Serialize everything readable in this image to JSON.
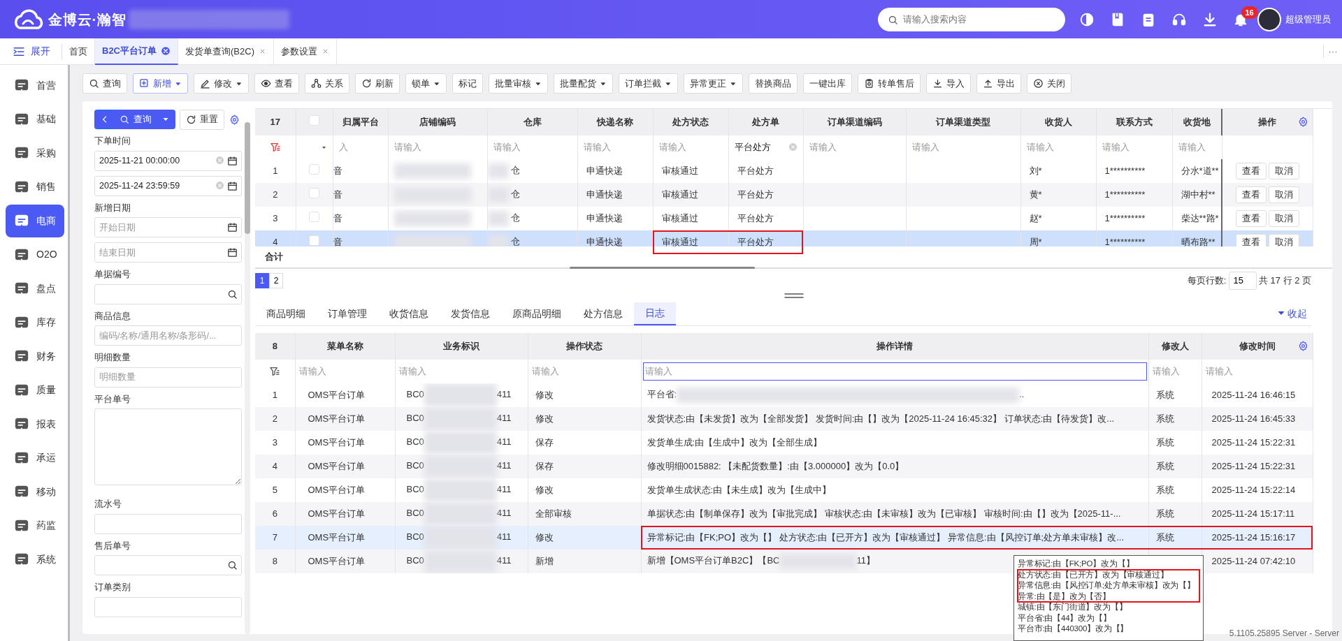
{
  "header": {
    "brand": "金博云·瀚智",
    "search_placeholder": "请输入搜索内容",
    "notifications": "16",
    "user": "超级管理员"
  },
  "tabs_bar": {
    "toggle": "展开",
    "more": "···",
    "tabs": [
      {
        "label": "首页",
        "selected": false,
        "closable": false
      },
      {
        "label": "B2C平台订单",
        "selected": true,
        "closable": true
      },
      {
        "label": "发货单查询(B2C)",
        "selected": false,
        "closable": true
      },
      {
        "label": "参数设置",
        "selected": false,
        "closable": true
      }
    ]
  },
  "sidebar": {
    "items": [
      {
        "label": "首营",
        "selected": false
      },
      {
        "label": "基础",
        "selected": false
      },
      {
        "label": "采购",
        "selected": false
      },
      {
        "label": "销售",
        "selected": false
      },
      {
        "label": "电商",
        "selected": true
      },
      {
        "label": "O2O",
        "selected": false
      },
      {
        "label": "盘点",
        "selected": false
      },
      {
        "label": "库存",
        "selected": false
      },
      {
        "label": "财务",
        "selected": false
      },
      {
        "label": "质量",
        "selected": false
      },
      {
        "label": "报表",
        "selected": false
      },
      {
        "label": "承运",
        "selected": false
      },
      {
        "label": "移动",
        "selected": false
      },
      {
        "label": "药监",
        "selected": false
      },
      {
        "label": "系统",
        "selected": false
      }
    ]
  },
  "toolbar": [
    {
      "label": "查询",
      "dropdown": false,
      "accent": false
    },
    {
      "label": "新增",
      "dropdown": true,
      "accent": true
    },
    {
      "label": "修改",
      "dropdown": true,
      "accent": false
    },
    {
      "label": "查看",
      "dropdown": false,
      "accent": false
    },
    {
      "label": "关系",
      "dropdown": false,
      "accent": false
    },
    {
      "label": "刷新",
      "dropdown": false,
      "accent": false
    },
    {
      "label": "锁单",
      "dropdown": true,
      "accent": false
    },
    {
      "label": "标记",
      "dropdown": false,
      "accent": false
    },
    {
      "label": "批量审核",
      "dropdown": true,
      "accent": false
    },
    {
      "label": "批量配货",
      "dropdown": true,
      "accent": false
    },
    {
      "label": "订单拦截",
      "dropdown": true,
      "accent": false
    },
    {
      "label": "异常更正",
      "dropdown": true,
      "accent": false
    },
    {
      "label": "替换商品",
      "dropdown": false,
      "accent": false
    },
    {
      "label": "一键出库",
      "dropdown": false,
      "accent": false
    },
    {
      "label": "转单售后",
      "dropdown": false,
      "accent": false
    },
    {
      "label": "导入",
      "dropdown": false,
      "accent": false
    },
    {
      "label": "导出",
      "dropdown": false,
      "accent": false
    },
    {
      "label": "关闭",
      "dropdown": false,
      "accent": false
    }
  ],
  "filter_panel": {
    "query": "查询",
    "reset": "重置",
    "fields": [
      {
        "label": "下单时间",
        "kind": "date",
        "value": "2025-11-21 00:00:00"
      },
      {
        "kind": "date",
        "value": "2025-11-24 23:59:59"
      },
      {
        "label": "新增日期",
        "kind": "date",
        "placeholder": "开始日期"
      },
      {
        "kind": "date",
        "placeholder": "结束日期"
      },
      {
        "label": "单据编号",
        "kind": "search"
      },
      {
        "label": "商品信息",
        "kind": "text",
        "placeholder": "编码/名称/通用名称/条形码/..."
      },
      {
        "label": "明细数量",
        "kind": "text",
        "placeholder": "明细数量"
      },
      {
        "label": "平台单号",
        "kind": "textarea"
      },
      {
        "label": "流水号",
        "kind": "text"
      },
      {
        "label": "售后单号",
        "kind": "search"
      },
      {
        "label": "订单类别",
        "kind": "text"
      }
    ]
  },
  "orders": {
    "count": "17",
    "all_checked": false,
    "columns": [
      "归属平台",
      "店铺编码",
      "仓库",
      "快递名称",
      "处方状态",
      "处方单",
      "订单渠道编码",
      "订单渠道类型",
      "收货人",
      "联系方式",
      "收货地",
      "操作"
    ],
    "filters": [
      "入",
      "请输入",
      "请输入",
      "请输入",
      "请输入",
      "平台处方",
      "请输入",
      "请输入",
      "请输入",
      "请输入",
      "请输入"
    ],
    "rows": [
      {
        "no": "1",
        "checked": false,
        "selected": false,
        "flagged": false,
        "platform": "音",
        "warehouse": "仓",
        "courier": "申通快递",
        "rx_status": "审核通过",
        "rx": "平台处方",
        "receiver": "刘*",
        "phone": "1**********",
        "address": "分水*道**",
        "actions": [
          "查看",
          "取消"
        ]
      },
      {
        "no": "2",
        "checked": false,
        "selected": false,
        "flagged": false,
        "platform": "音",
        "warehouse": "仓",
        "courier": "申通快递",
        "rx_status": "审核通过",
        "rx": "平台处方",
        "receiver": "黄*",
        "phone": "1**********",
        "address": "湖中村**",
        "actions": [
          "查看",
          "取消"
        ]
      },
      {
        "no": "3",
        "checked": false,
        "selected": false,
        "flagged": false,
        "platform": "音",
        "warehouse": "仓",
        "courier": "申通快递",
        "rx_status": "审核通过",
        "rx": "平台处方",
        "receiver": "赵*",
        "phone": "1**********",
        "address": "柴达**路*",
        "actions": [
          "查看",
          "取消"
        ]
      },
      {
        "no": "4",
        "checked": false,
        "selected": true,
        "flagged": true,
        "platform": "音",
        "warehouse": "仓",
        "courier": "申通快递",
        "rx_status": "审核通过",
        "rx": "平台处方",
        "receiver": "周*",
        "phone": "1**********",
        "address": "晒布路**",
        "actions": [
          "查看",
          "取消"
        ]
      }
    ],
    "summary": "合计",
    "pages": [
      {
        "label": "1",
        "selected": true
      },
      {
        "label": "2",
        "selected": false
      }
    ],
    "page_size_label": "每页行数:",
    "page_size": "15",
    "total": "共 17 行 2 页"
  },
  "detail_tabs": {
    "collapse": "收起",
    "tabs": [
      {
        "label": "商品明细",
        "selected": false
      },
      {
        "label": "订单管理",
        "selected": false
      },
      {
        "label": "收货信息",
        "selected": false
      },
      {
        "label": "发货信息",
        "selected": false
      },
      {
        "label": "原商品明细",
        "selected": false
      },
      {
        "label": "处方信息",
        "selected": false
      },
      {
        "label": "日志",
        "selected": true
      }
    ]
  },
  "log": {
    "count": "8",
    "columns": [
      "菜单名称",
      "业务标识",
      "操作状态",
      "操作详情",
      "修改人",
      "修改时间"
    ],
    "filters": [
      {
        "placeholder": "请输入",
        "focused": false
      },
      {
        "placeholder": "请输入",
        "focused": false
      },
      {
        "placeholder": "请输入",
        "focused": false
      },
      {
        "placeholder": "请输入",
        "focused": true
      },
      {
        "placeholder": "请输入",
        "focused": false
      },
      {
        "placeholder": "请输入",
        "focused": false
      }
    ],
    "rows": [
      {
        "no": "1",
        "menu": "OMS平台订单",
        "id_start": "BC0",
        "id_end": "411",
        "status": "修改",
        "detail": "平台省:",
        "detail_redacted": true,
        "detail_end": "..",
        "user": "系统",
        "time": "2025-11-24 16:46:15",
        "selected": false,
        "flagged": false
      },
      {
        "no": "2",
        "menu": "OMS平台订单",
        "id_start": "BC0",
        "id_end": "411",
        "status": "修改",
        "detail": "发货状态:由【未发货】改为【全部发货】 发货时间:由【】改为【2025-11-24 16:45:32】 订单状态:由【待发货】改...",
        "user": "系统",
        "time": "2025-11-24 16:45:33",
        "selected": false,
        "flagged": false
      },
      {
        "no": "3",
        "menu": "OMS平台订单",
        "id_start": "BC0",
        "id_end": "411",
        "status": "保存",
        "detail": "发货单生成:由【生成中】改为【全部生成】",
        "user": "系统",
        "time": "2025-11-24 15:22:31",
        "selected": false,
        "flagged": false
      },
      {
        "no": "4",
        "menu": "OMS平台订单",
        "id_start": "BC0",
        "id_end": "411",
        "status": "保存",
        "detail": "修改明细0015882: 【未配货数量】:由【3.000000】改为【0.0】",
        "user": "系统",
        "time": "2025-11-24 15:22:31",
        "selected": false,
        "flagged": false
      },
      {
        "no": "5",
        "menu": "OMS平台订单",
        "id_start": "BC0",
        "id_end": "411",
        "status": "修改",
        "detail": "发货单生成状态:由【未生成】改为【生成中】",
        "user": "系统",
        "time": "2025-11-24 15:22:14",
        "selected": false,
        "flagged": false
      },
      {
        "no": "6",
        "menu": "OMS平台订单",
        "id_start": "BC0",
        "id_end": "411",
        "status": "全部审核",
        "detail": "单据状态:由【制单保存】改为【审批完成】 审核状态:由【未审核】改为【已审核】 审核时间:由【】改为【2025-11-...",
        "user": "系统",
        "time": "2025-11-24 15:17:11",
        "selected": false,
        "flagged": false
      },
      {
        "no": "7",
        "menu": "OMS平台订单",
        "id_start": "BC0",
        "id_end": "411",
        "status": "修改",
        "detail": "异常标记:由【FK;PO】改为【】 处方状态:由【已开方】改为【审核通过】 异常信息:由【风控订单;处方单未审核】改...",
        "user": "系统",
        "time": "2025-11-24 15:16:17",
        "selected": true,
        "flagged": true
      },
      {
        "no": "8",
        "menu": "OMS平台订单",
        "id_start": "BC0",
        "id_end": "411",
        "status": "新增",
        "detail": "新增【OMS平台订单B2C】【BC",
        "detail_redacted": true,
        "detail_end": "11】",
        "time": "2025-11-24 07:42:10",
        "selected": false,
        "flagged": false
      }
    ]
  },
  "tooltip": {
    "lines": [
      {
        "text": "异常标记:由【FK;PO】改为【】",
        "flagged": false
      },
      {
        "text": "处方状态:由【已开方】改为【审核通过】",
        "flagged": true
      },
      {
        "text": "异常信息:由【风控订单;处方单未审核】改为【】",
        "flagged": true
      },
      {
        "text": "异常:由【是】改为【否】",
        "flagged": true
      },
      {
        "text": "城镇:由【东门街道】改为【】",
        "flagged": false
      },
      {
        "text": "平台省:由【44】改为【】",
        "flagged": false
      },
      {
        "text": "平台市:由【440300】改为【】",
        "flagged": false
      }
    ]
  },
  "version": "5.1105.25895 Server - Server"
}
